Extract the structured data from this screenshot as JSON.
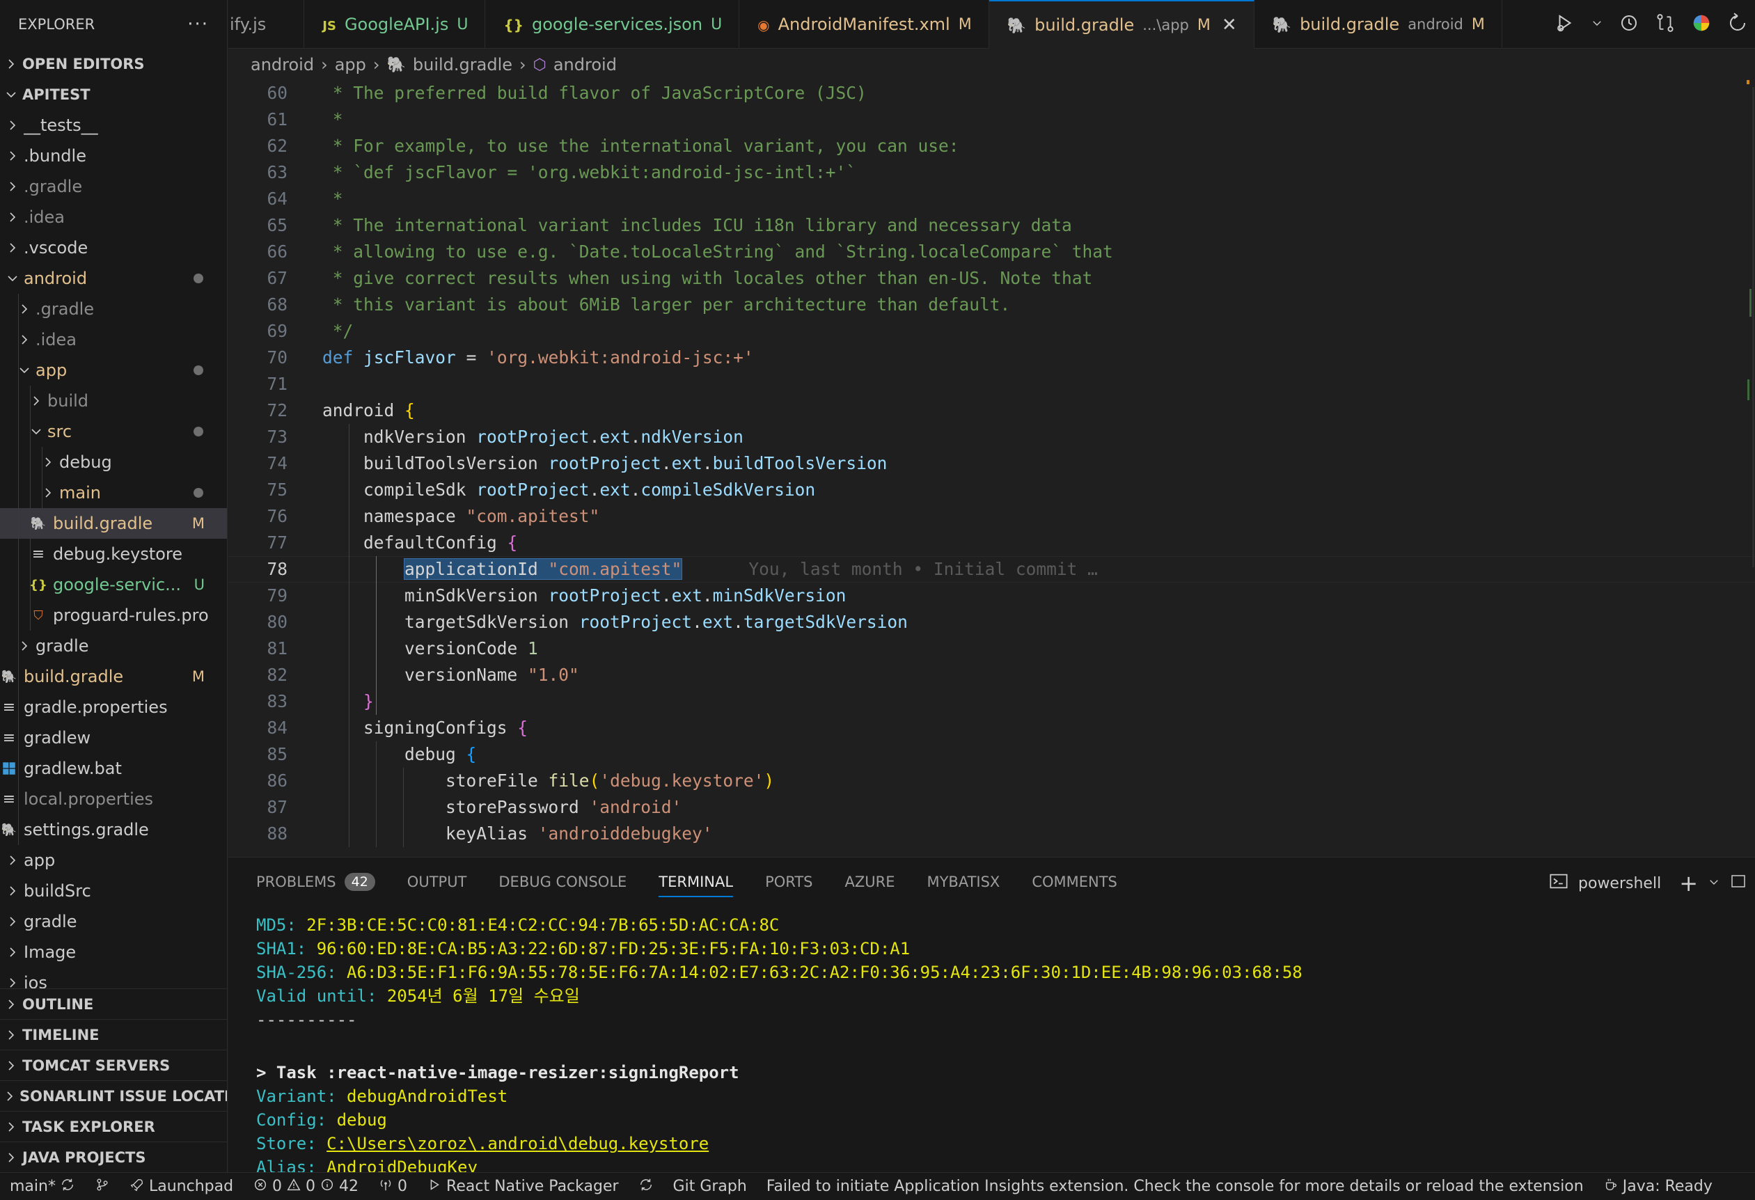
{
  "sidebar": {
    "title": "EXPLORER",
    "more": "···",
    "open_editors": "OPEN EDITORS",
    "root": "APITEST",
    "tree": [
      {
        "label": "__tests__",
        "depth": 0,
        "expanded": false,
        "kind": "folder",
        "state": ""
      },
      {
        "label": ".bundle",
        "depth": 0,
        "expanded": false,
        "kind": "folder",
        "state": ""
      },
      {
        "label": ".gradle",
        "depth": 0,
        "expanded": false,
        "kind": "folder",
        "state": "dim"
      },
      {
        "label": ".idea",
        "depth": 0,
        "expanded": false,
        "kind": "folder",
        "state": "dim"
      },
      {
        "label": ".vscode",
        "depth": 0,
        "expanded": false,
        "kind": "folder",
        "state": ""
      },
      {
        "label": "android",
        "depth": 0,
        "expanded": true,
        "kind": "folder",
        "state": "mod",
        "dot": true
      },
      {
        "label": ".gradle",
        "depth": 1,
        "expanded": false,
        "kind": "folder",
        "state": "dim"
      },
      {
        "label": ".idea",
        "depth": 1,
        "expanded": false,
        "kind": "folder",
        "state": "dim"
      },
      {
        "label": "app",
        "depth": 1,
        "expanded": true,
        "kind": "folder",
        "state": "mod",
        "dot": true
      },
      {
        "label": "build",
        "depth": 2,
        "expanded": false,
        "kind": "folder",
        "state": "dim"
      },
      {
        "label": "src",
        "depth": 2,
        "expanded": true,
        "kind": "folder",
        "state": "mod",
        "dot": true
      },
      {
        "label": "debug",
        "depth": 3,
        "expanded": false,
        "kind": "folder",
        "state": ""
      },
      {
        "label": "main",
        "depth": 3,
        "expanded": false,
        "kind": "folder",
        "state": "mod",
        "dot": true
      },
      {
        "label": "build.gradle",
        "depth": 2,
        "kind": "gradle",
        "state": "mod",
        "badge": "M",
        "selected": true
      },
      {
        "label": "debug.keystore",
        "depth": 2,
        "kind": "lines",
        "state": ""
      },
      {
        "label": "google-servic...",
        "depth": 2,
        "kind": "json",
        "state": "untracked",
        "badge": "U"
      },
      {
        "label": "proguard-rules.pro",
        "depth": 2,
        "kind": "pro",
        "state": ""
      },
      {
        "label": "gradle",
        "depth": 1,
        "expanded": false,
        "kind": "folder",
        "state": ""
      },
      {
        "label": "build.gradle",
        "depth": 1,
        "kind": "gradle",
        "state": "mod",
        "badge": "M"
      },
      {
        "label": "gradle.properties",
        "depth": 1,
        "kind": "lines",
        "state": ""
      },
      {
        "label": "gradlew",
        "depth": 1,
        "kind": "lines",
        "state": ""
      },
      {
        "label": "gradlew.bat",
        "depth": 1,
        "kind": "win",
        "state": ""
      },
      {
        "label": "local.properties",
        "depth": 1,
        "kind": "lines",
        "state": "dim"
      },
      {
        "label": "settings.gradle",
        "depth": 1,
        "kind": "gradle",
        "state": ""
      },
      {
        "label": "app",
        "depth": 0,
        "expanded": false,
        "kind": "folder",
        "state": ""
      },
      {
        "label": "buildSrc",
        "depth": 0,
        "expanded": false,
        "kind": "folder",
        "state": ""
      },
      {
        "label": "gradle",
        "depth": 0,
        "expanded": false,
        "kind": "folder",
        "state": ""
      },
      {
        "label": "Image",
        "depth": 0,
        "expanded": false,
        "kind": "folder",
        "state": ""
      },
      {
        "label": "ios",
        "depth": 0,
        "expanded": false,
        "kind": "folder",
        "state": ""
      }
    ],
    "bottom_sections": [
      "OUTLINE",
      "TIMELINE",
      "TOMCAT SERVERS",
      "SONARLINT ISSUE LOCATI...",
      "TASK EXPLORER",
      "JAVA PROJECTS"
    ]
  },
  "tabs": [
    {
      "label": "ify.js",
      "icon": "",
      "badge": "",
      "desc": "",
      "active": false
    },
    {
      "label": "GoogleAPI.js",
      "icon": "JS",
      "badge": "U",
      "desc": "",
      "active": false
    },
    {
      "label": "google-services.json",
      "icon": "{}",
      "badge": "U",
      "desc": "",
      "active": false
    },
    {
      "label": "AndroidManifest.xml",
      "icon": "rss",
      "badge": "M",
      "desc": "",
      "active": false
    },
    {
      "label": "build.gradle",
      "icon": "gradle",
      "badge": "M",
      "desc": "...\\app",
      "active": true,
      "close": "✕"
    },
    {
      "label": "build.gradle",
      "icon": "gradle",
      "badge": "M",
      "desc": "android",
      "active": false
    }
  ],
  "breadcrumb": [
    "android",
    "app",
    "build.gradle",
    "android"
  ],
  "editor": {
    "current_line": 78,
    "lines": [
      {
        "n": 60,
        "html": "<span class='c-com'> * The preferred build flavor of JavaScriptCore (JSC)</span>"
      },
      {
        "n": 61,
        "html": "<span class='c-com'> *</span>"
      },
      {
        "n": 62,
        "html": "<span class='c-com'> * For example, to use the international variant, you can use:</span>"
      },
      {
        "n": 63,
        "html": "<span class='c-com'> * `def jscFlavor = 'org.webkit:android-jsc-intl:+'`</span>"
      },
      {
        "n": 64,
        "html": "<span class='c-com'> *</span>"
      },
      {
        "n": 65,
        "html": "<span class='c-com'> * The international variant includes ICU i18n library and necessary data</span>"
      },
      {
        "n": 66,
        "html": "<span class='c-com'> * allowing to use e.g. `Date.toLocaleString` and `String.localeCompare` that</span>"
      },
      {
        "n": 67,
        "html": "<span class='c-com'> * give correct results when using with locales other than en-US. Note that</span>"
      },
      {
        "n": 68,
        "html": "<span class='c-com'> * this variant is about 6MiB larger per architecture than default.</span>"
      },
      {
        "n": 69,
        "html": "<span class='c-com'> */</span>"
      },
      {
        "n": 70,
        "html": "<span class='c-kw'>def</span> <span class='c-id'>jscFlavor</span> <span class='c-txt'>=</span> <span class='c-str'>'org.webkit:android-jsc:+'</span>"
      },
      {
        "n": 71,
        "html": ""
      },
      {
        "n": 72,
        "html": "<span class='c-txt'>android</span> <span class='c-br1'>{</span>"
      },
      {
        "n": 73,
        "html": "    <span class='c-txt'>ndkVersion</span> <span class='c-id'>rootProject</span><span class='c-txt'>.</span><span class='c-id'>ext</span><span class='c-txt'>.</span><span class='c-id'>ndkVersion</span>"
      },
      {
        "n": 74,
        "html": "    <span class='c-txt'>buildToolsVersion</span> <span class='c-id'>rootProject</span><span class='c-txt'>.</span><span class='c-id'>ext</span><span class='c-txt'>.</span><span class='c-id'>buildToolsVersion</span>"
      },
      {
        "n": 75,
        "html": "    <span class='c-txt'>compileSdk</span> <span class='c-id'>rootProject</span><span class='c-txt'>.</span><span class='c-id'>ext</span><span class='c-txt'>.</span><span class='c-id'>compileSdkVersion</span>"
      },
      {
        "n": 76,
        "html": "    <span class='c-txt'>namespace</span> <span class='c-str'>\"com.apitest\"</span>"
      },
      {
        "n": 77,
        "html": "    <span class='c-txt'>defaultConfig</span> <span class='c-br2'>{</span>"
      },
      {
        "n": 78,
        "html": "        <span class='sel'><span class='c-txt'>applicationId</span> <span class='c-str'>\"com.apitest\"</span></span><span class='blame'>You, last month • Initial commit …</span>"
      },
      {
        "n": 79,
        "html": "        <span class='c-txt'>minSdkVersion</span> <span class='c-id'>rootProject</span><span class='c-txt'>.</span><span class='c-id'>ext</span><span class='c-txt'>.</span><span class='c-id'>minSdkVersion</span>"
      },
      {
        "n": 80,
        "html": "        <span class='c-txt'>targetSdkVersion</span> <span class='c-id'>rootProject</span><span class='c-txt'>.</span><span class='c-id'>ext</span><span class='c-txt'>.</span><span class='c-id'>targetSdkVersion</span>"
      },
      {
        "n": 81,
        "html": "        <span class='c-txt'>versionCode</span> <span class='c-num'>1</span>"
      },
      {
        "n": 82,
        "html": "        <span class='c-txt'>versionName</span> <span class='c-str'>\"1.0\"</span>"
      },
      {
        "n": 83,
        "html": "    <span class='c-br2'>}</span>"
      },
      {
        "n": 84,
        "html": "    <span class='c-txt'>signingConfigs</span> <span class='c-br2'>{</span>"
      },
      {
        "n": 85,
        "html": "        <span class='c-txt'>debug</span> <span class='c-br3'>{</span>"
      },
      {
        "n": 86,
        "html": "            <span class='c-txt'>storeFile</span> <span class='c-fn'>file</span><span class='c-br1'>(</span><span class='c-str'>'debug.keystore'</span><span class='c-br1'>)</span>"
      },
      {
        "n": 87,
        "html": "            <span class='c-txt'>storePassword</span> <span class='c-str'>'android'</span>"
      },
      {
        "n": 88,
        "html": "            <span class='c-txt'>keyAlias</span> <span class='c-str'>'androiddebugkey'</span>"
      }
    ]
  },
  "panel": {
    "tabs": [
      {
        "label": "PROBLEMS",
        "badge": "42",
        "active": false
      },
      {
        "label": "OUTPUT",
        "badge": "",
        "active": false
      },
      {
        "label": "DEBUG CONSOLE",
        "badge": "",
        "active": false
      },
      {
        "label": "TERMINAL",
        "badge": "",
        "active": true
      },
      {
        "label": "PORTS",
        "badge": "",
        "active": false
      },
      {
        "label": "AZURE",
        "badge": "",
        "active": false
      },
      {
        "label": "MYBATISX",
        "badge": "",
        "active": false
      },
      {
        "label": "COMMENTS",
        "badge": "",
        "active": false
      }
    ],
    "shell": "powershell",
    "terminal": [
      {
        "label": "MD5: ",
        "value": "2F:3B:CE:5C:C0:81:E4:C2:CC:94:7B:65:5D:AC:CA:8C",
        "style": "kv"
      },
      {
        "label": "SHA1: ",
        "value": "96:60:ED:8E:CA:B5:A3:22:6D:87:FD:25:3E:F5:FA:10:F3:03:CD:A1",
        "style": "kv"
      },
      {
        "label": "SHA-256: ",
        "value": "A6:D3:5E:F1:F6:9A:55:78:5E:F6:7A:14:02:E7:63:2C:A2:F0:36:95:A4:23:6F:30:1D:EE:4B:98:96:03:68:58",
        "style": "kv"
      },
      {
        "label": "Valid until: ",
        "value": "2054년 6월 17일 수요일",
        "style": "kv"
      },
      {
        "label": "----------",
        "value": "",
        "style": "plain"
      },
      {
        "label": "",
        "value": "",
        "style": "plain"
      },
      {
        "label": "> Task :react-native-image-resizer:signingReport",
        "value": "",
        "style": "bold"
      },
      {
        "label": "Variant: ",
        "value": "debugAndroidTest",
        "style": "kv"
      },
      {
        "label": "Config: ",
        "value": "debug",
        "style": "kv"
      },
      {
        "label": "Store: ",
        "value": "C:\\Users\\zoroz\\.android\\debug.keystore",
        "style": "link"
      },
      {
        "label": "Alias: ",
        "value": "AndroidDebugKey",
        "style": "kv"
      }
    ]
  },
  "statusbar": {
    "branch": "main*",
    "launchpad": "Launchpad",
    "errors": "0",
    "warnings": "0",
    "infos": "42",
    "ports": "0",
    "packager": "React Native Packager",
    "gitgraph": "Git Graph",
    "message": "Failed to initiate Application Insights extension. Check the console for more details or reload the extension",
    "java": "Java: Ready"
  },
  "colors": {
    "accent": "#0078d4",
    "modified": "#e2c08d",
    "untracked": "#73c991",
    "terminal_label": "#3ac0c6",
    "terminal_value": "#e5e510"
  }
}
